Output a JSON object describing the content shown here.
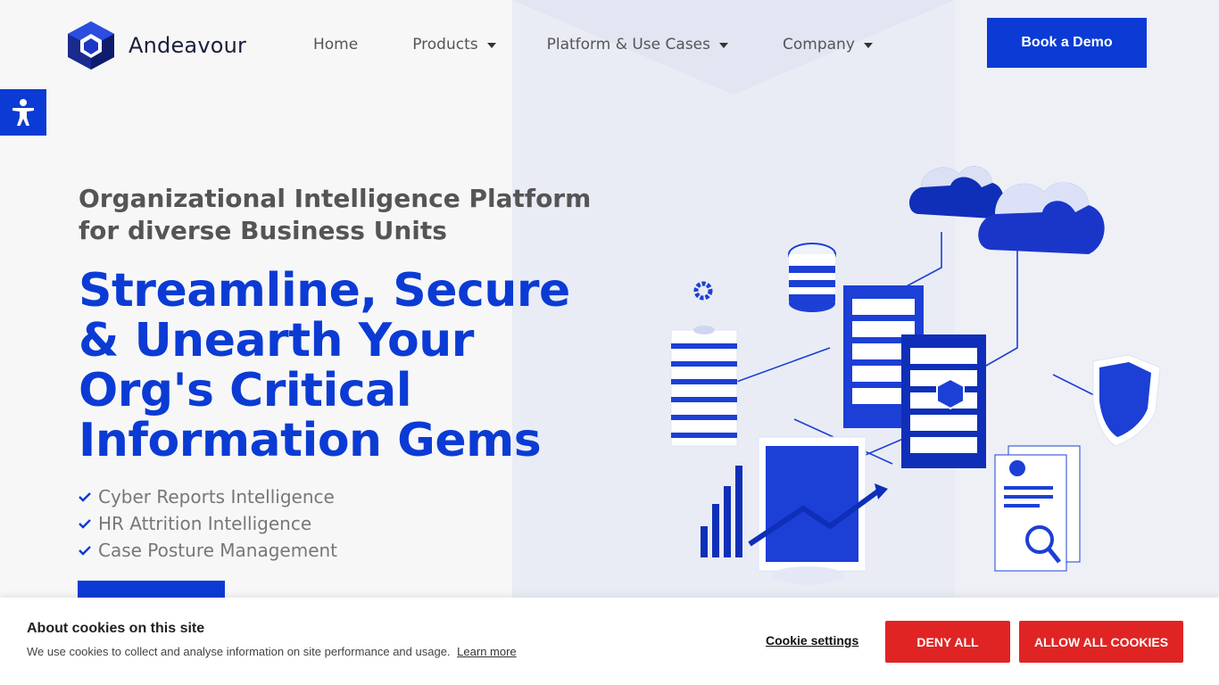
{
  "brand": {
    "name": "Andeavour",
    "logo_icon": "hexagon-cube-icon",
    "accent_color": "#0b3bd4"
  },
  "nav": {
    "items": [
      {
        "label": "Home",
        "has_dropdown": false
      },
      {
        "label": "Products",
        "has_dropdown": true
      },
      {
        "label": "Platform & Use Cases",
        "has_dropdown": true
      },
      {
        "label": "Company",
        "has_dropdown": true
      }
    ],
    "cta_label": "Book a Demo"
  },
  "accessibility": {
    "icon": "accessibility-person-icon"
  },
  "hero": {
    "subheading_line1": "Organizational Intelligence Platform",
    "subheading_line2": "for diverse Business Units",
    "headline_lines": [
      "Streamline, Secure",
      "& Unearth Your",
      "Org's Critical",
      "Information Gems"
    ],
    "features": [
      "Cyber Reports Intelligence",
      "HR Attrition Intelligence",
      "Case Posture Management"
    ],
    "check_icon": "check-icon",
    "illustration": "isometric-cloud-server-illustration"
  },
  "cookie_banner": {
    "title": "About cookies on this site",
    "text": "We use cookies to collect and analyse information on site performance and usage.",
    "learn_more": "Learn more",
    "settings_label": "Cookie settings",
    "deny_label": "DENY ALL",
    "allow_label": "ALLOW ALL COOKIES",
    "button_color": "#e02424"
  }
}
